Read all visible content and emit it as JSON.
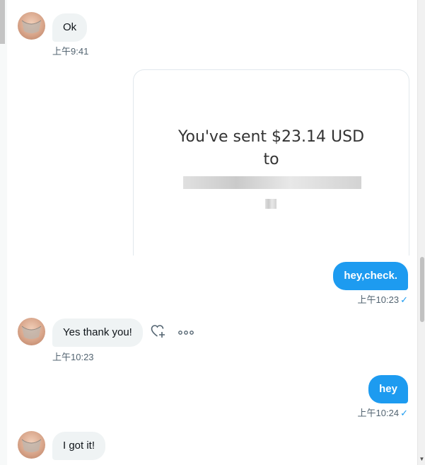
{
  "messages": [
    {
      "id": "m1",
      "direction": "in",
      "text": "Ok",
      "time": "上午9:41"
    },
    {
      "id": "m2",
      "direction": "out",
      "type": "payment-card",
      "card_line1": "You've sent $23.14 USD",
      "card_line2": "to"
    },
    {
      "id": "m3",
      "direction": "out",
      "text": "hey,check.",
      "time": "上午10:23"
    },
    {
      "id": "m4",
      "direction": "in",
      "text": "Yes thank you!",
      "time": "上午10:23"
    },
    {
      "id": "m5",
      "direction": "out",
      "text": "hey",
      "time": "上午10:24"
    },
    {
      "id": "m6",
      "direction": "in",
      "text": "I got it!"
    }
  ],
  "status": {
    "read_mark": "✓"
  },
  "icons": {
    "react": "heart-plus-icon",
    "more": "more-options-icon"
  },
  "colors": {
    "accent": "#1d9bf0",
    "incoming_bubble": "#eff3f4",
    "muted_text": "#536471"
  }
}
